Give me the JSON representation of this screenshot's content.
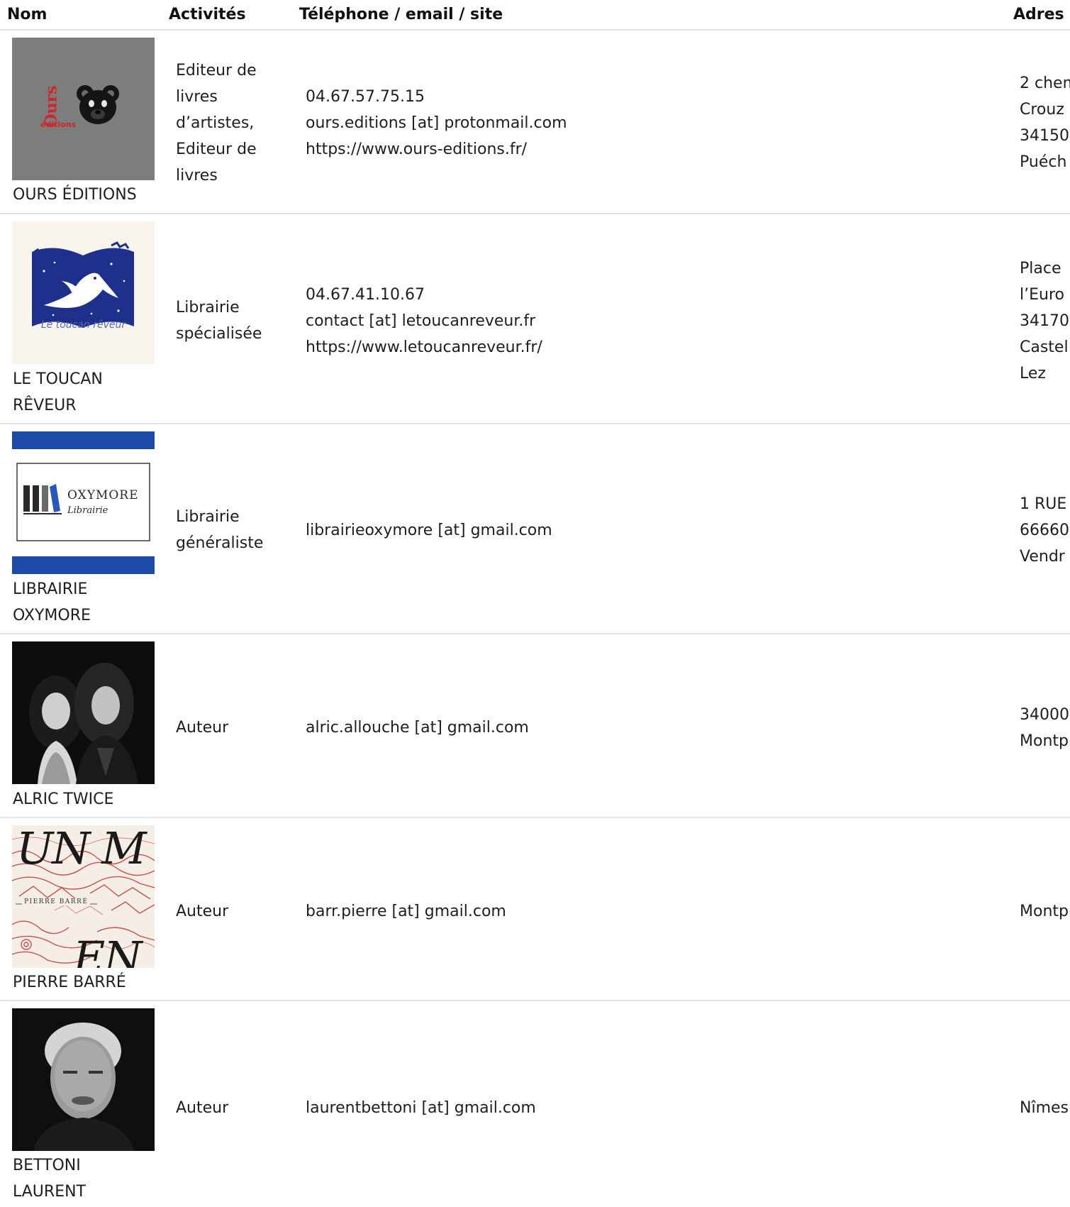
{
  "table": {
    "headers": {
      "name": "Nom",
      "activities": "Activités",
      "contact": "Téléphone / email / site",
      "address": "Adres"
    },
    "rows": [
      {
        "name": "OURS ÉDITIONS",
        "logo": "ours-editions-teddy-logo",
        "activity_lines": [
          "Editeur de",
          "livres",
          "d’artistes,",
          "Editeur de",
          "livres"
        ],
        "contact_lines": [
          "04.67.57.75.15",
          "ours.editions [at] protonmail.com",
          "https://www.ours-editions.fr/"
        ],
        "address_lines": [
          "2 chem",
          "Crouz",
          "34150",
          "Puéch"
        ],
        "logo_text": "Ours éditions"
      },
      {
        "name_lines": [
          "LE TOUCAN",
          "RÊVEUR"
        ],
        "logo": "toucan-book-logo",
        "logo_text": "Le toucan rêveur",
        "activity_lines": [
          "Librairie",
          "spécialisée"
        ],
        "contact_lines": [
          "04.67.41.10.67",
          "contact [at] letoucanreveur.fr",
          "https://www.letoucanreveur.fr/"
        ],
        "address_lines": [
          "Place",
          "l’Euro",
          "34170",
          "Castel",
          "Lez"
        ]
      },
      {
        "name_lines": [
          "LIBRAIRIE",
          "OXYMORE"
        ],
        "logo": "oxymore-books-logo",
        "logo_text": [
          "OXYMORE",
          "Librairie"
        ],
        "activity_lines": [
          "Librairie",
          "généraliste"
        ],
        "contact_lines": [
          "librairieoxymore [at] gmail.com"
        ],
        "address_lines": [
          "1 RUE",
          "66660",
          "Vendr"
        ]
      },
      {
        "name": "ALRIC TWICE",
        "logo": "portrait-photo-duo",
        "activity_lines": [
          "Auteur"
        ],
        "contact_lines": [
          "alric.allouche [at] gmail.com"
        ],
        "address_lines": [
          "34000",
          "Montp"
        ]
      },
      {
        "name": "PIERRE BARRÉ",
        "logo": "book-cover-illustration",
        "logo_text": [
          "UN M",
          "PIERRE BARRÉ",
          "EN"
        ],
        "activity_lines": [
          "Auteur"
        ],
        "contact_lines": [
          "barr.pierre [at] gmail.com"
        ],
        "address_lines": [
          "Montp"
        ]
      },
      {
        "name_lines": [
          "BETTONI",
          "LAURENT"
        ],
        "logo": "portrait-photo-man",
        "activity_lines": [
          "Auteur"
        ],
        "contact_lines": [
          "laurentbettoni [at] gmail.com"
        ],
        "address_lines": [
          "Nîmes"
        ]
      }
    ]
  },
  "colors": {
    "text": "#1e1e1e",
    "divider": "#e3e3e3",
    "ours_bg": "#7d7d7d",
    "ours_red": "#d0262a",
    "toucan_blue": "#1e2f8c",
    "oxymore_blue": "#1c4ba8"
  }
}
